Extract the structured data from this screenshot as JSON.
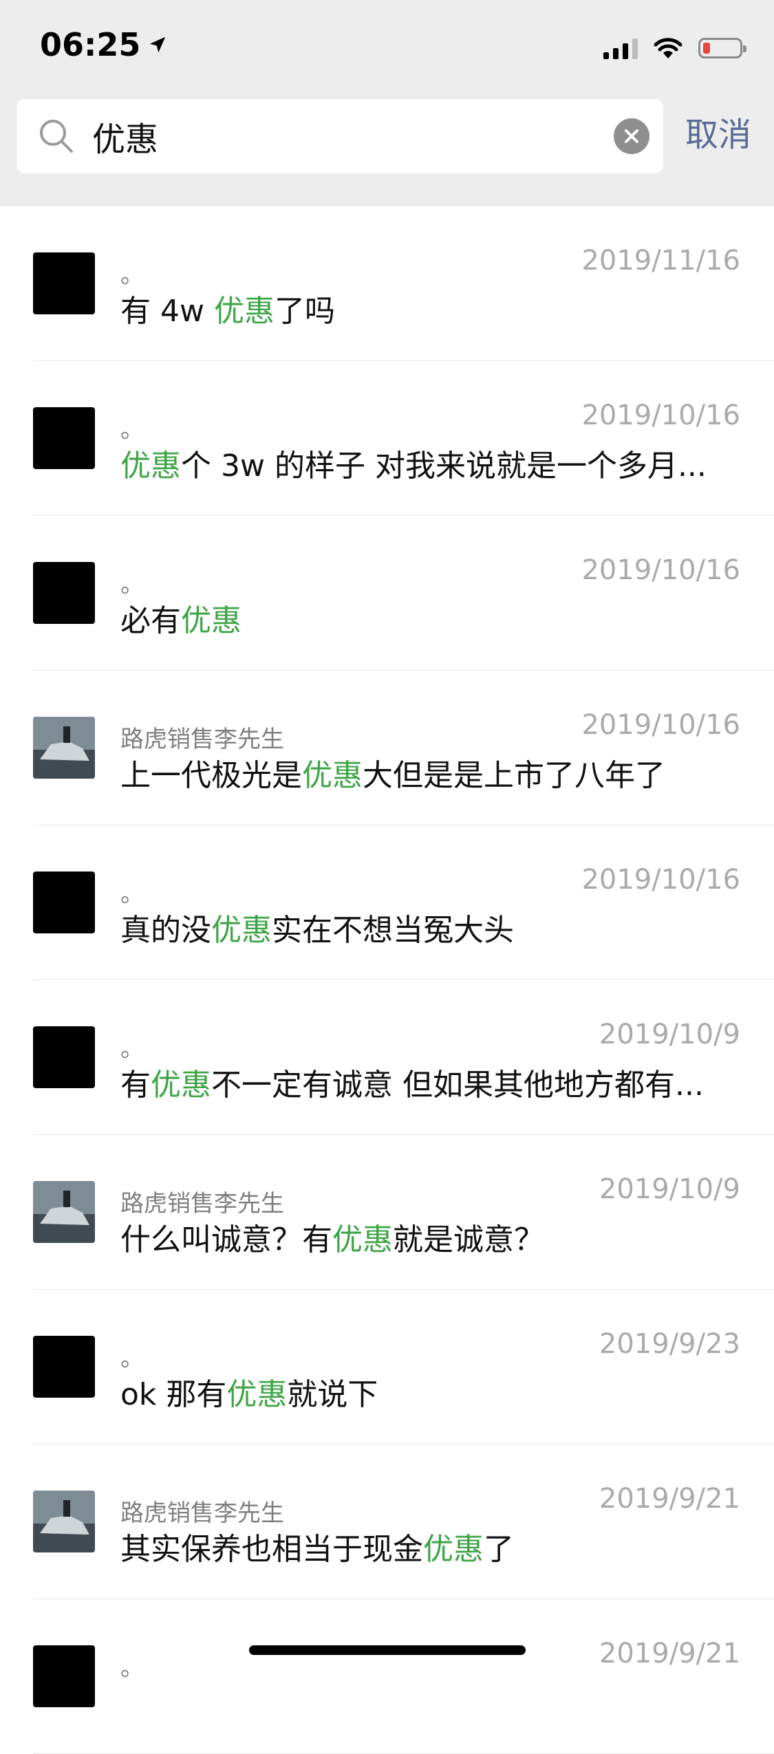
{
  "status_bar": {
    "time": "06:25",
    "battery_color": "#e8453c"
  },
  "search": {
    "query": "优惠",
    "cancel_label": "取消"
  },
  "colors": {
    "highlight": "#3fa447",
    "cancel": "#576b95"
  },
  "results": [
    {
      "sender": "。",
      "date": "2019/11/16",
      "avatar": "black",
      "pre": "有 4w ",
      "hl": "优惠",
      "post": "了吗"
    },
    {
      "sender": "。",
      "date": "2019/10/16",
      "avatar": "black",
      "pre": "",
      "hl": "优惠",
      "post": "个 3w 的样子 对我来说就是一个多月..."
    },
    {
      "sender": "。",
      "date": "2019/10/16",
      "avatar": "black",
      "pre": "必有",
      "hl": "优惠",
      "post": ""
    },
    {
      "sender": "路虎销售李先生",
      "date": "2019/10/16",
      "avatar": "photo",
      "pre": "上一代极光是",
      "hl": "优惠",
      "post": "大但是是上市了八年了"
    },
    {
      "sender": "。",
      "date": "2019/10/16",
      "avatar": "black",
      "pre": "真的没",
      "hl": "优惠",
      "post": "实在不想当冤大头"
    },
    {
      "sender": "。",
      "date": "2019/10/9",
      "avatar": "black",
      "pre": "有",
      "hl": "优惠",
      "post": "不一定有诚意 但如果其他地方都有..."
    },
    {
      "sender": "路虎销售李先生",
      "date": "2019/10/9",
      "avatar": "photo",
      "pre": "什么叫诚意？有",
      "hl": "优惠",
      "post": "就是诚意？"
    },
    {
      "sender": "。",
      "date": "2019/9/23",
      "avatar": "black",
      "pre": "ok 那有",
      "hl": "优惠",
      "post": "就说下"
    },
    {
      "sender": "路虎销售李先生",
      "date": "2019/9/21",
      "avatar": "photo",
      "pre": "其实保养也相当于现金",
      "hl": "优惠",
      "post": "了"
    },
    {
      "sender": "。",
      "date": "2019/9/21",
      "avatar": "black",
      "pre": "",
      "hl": "",
      "post": ""
    }
  ]
}
